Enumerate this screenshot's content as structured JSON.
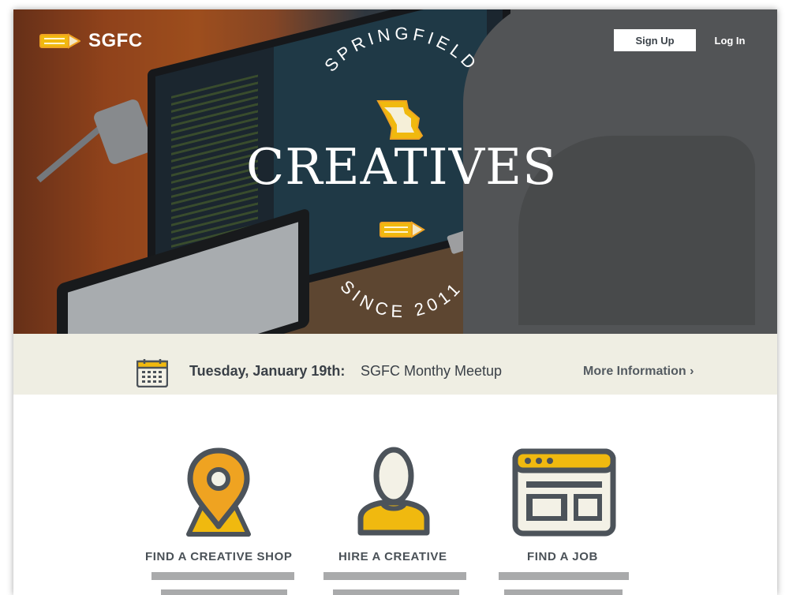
{
  "header": {
    "logo_text": "SGFC",
    "signup_label": "Sign Up",
    "login_label": "Log In"
  },
  "hero": {
    "arc_top": "SPRINGFIELD",
    "title": "CREATIVES",
    "arc_bottom": "SINCE 2011"
  },
  "event": {
    "date": "Tuesday, January 19th:",
    "name": "SGFC Monthy Meetup",
    "more_label": "More Information ›"
  },
  "features": [
    {
      "label": "FIND A CREATIVE SHOP",
      "icon": "map-pin-icon"
    },
    {
      "label": "HIRE A CREATIVE",
      "icon": "person-icon"
    },
    {
      "label": "FIND A JOB",
      "icon": "browser-window-icon"
    }
  ],
  "colors": {
    "accent_yellow": "#f0b90f",
    "accent_orange": "#efa321",
    "icon_dark": "#4c535a",
    "icon_cream": "#f3f1e6",
    "event_bg": "#efeee3",
    "placeholder_bar": "#a9aaab"
  }
}
